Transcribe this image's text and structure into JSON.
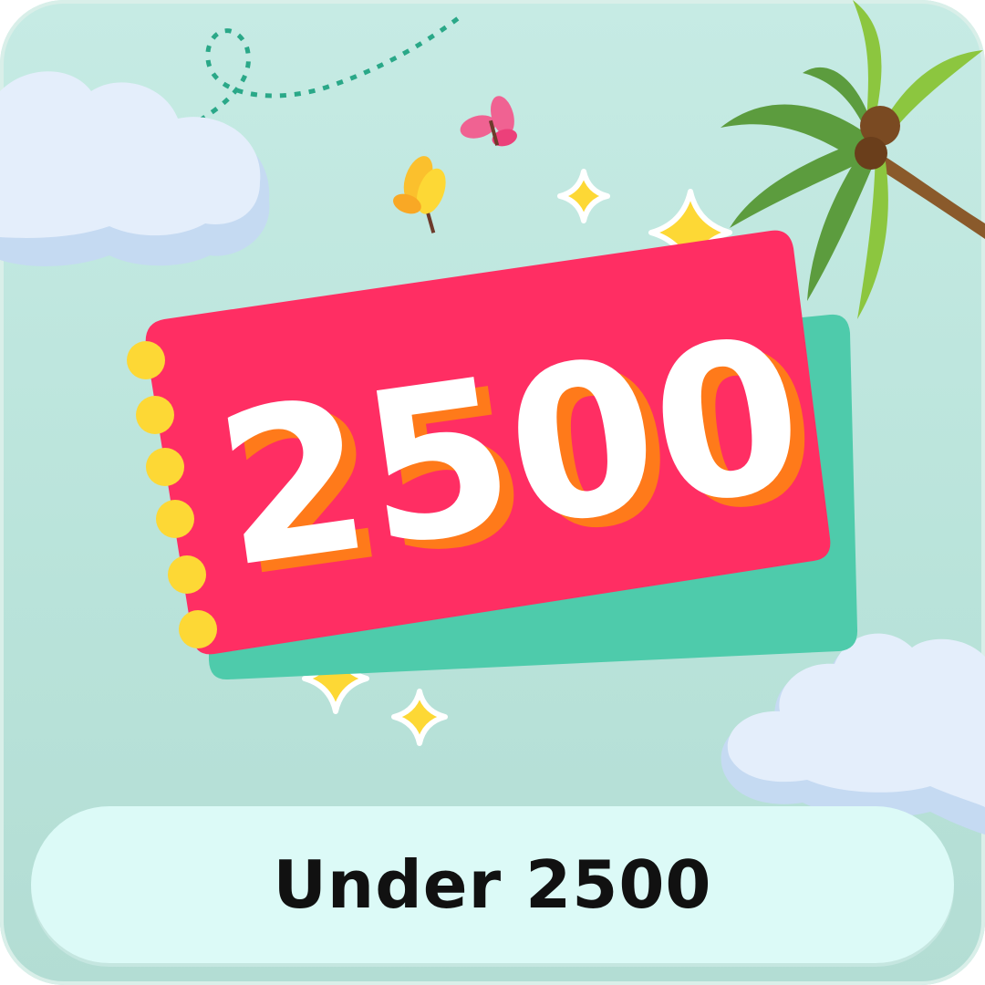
{
  "tile": {
    "amount": "2500",
    "label": "Under 2500"
  },
  "colors": {
    "ticket": "#ff2e63",
    "ticket_shadow": "#4ecbab",
    "number_shadow": "#ff7a1a",
    "dots": "#fdd835",
    "pill": "#dcfaf7"
  }
}
